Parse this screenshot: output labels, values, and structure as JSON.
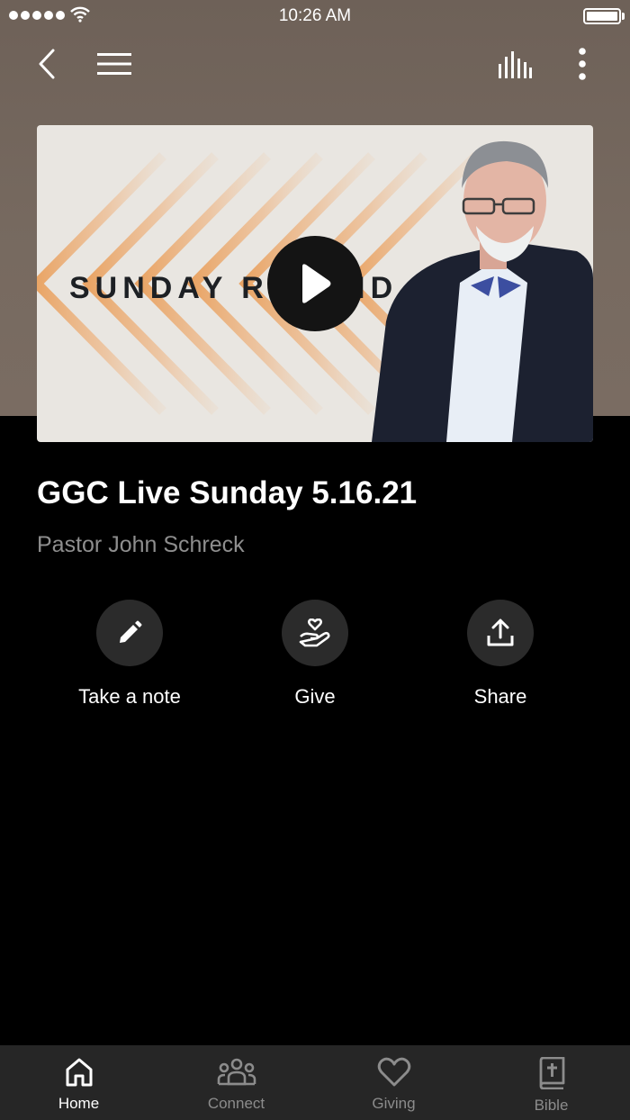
{
  "status_bar": {
    "time": "10:26 AM"
  },
  "nav": {
    "back_icon": "chevron-left-icon",
    "menu_icon": "hamburger-menu-icon",
    "audio_icon": "audio-bars-icon",
    "more_icon": "more-vertical-icon"
  },
  "video": {
    "thumbnail_text": "SUNDAY REWIND",
    "play_icon": "play-icon"
  },
  "sermon": {
    "title": "GGC Live Sunday 5.16.21",
    "speaker": "Pastor John Schreck"
  },
  "actions": [
    {
      "label": "Take a note",
      "icon": "pencil-icon"
    },
    {
      "label": "Give",
      "icon": "hand-heart-icon"
    },
    {
      "label": "Share",
      "icon": "share-upload-icon"
    }
  ],
  "tabs": [
    {
      "label": "Home",
      "icon": "home-icon",
      "active": true
    },
    {
      "label": "Connect",
      "icon": "people-icon",
      "active": false
    },
    {
      "label": "Giving",
      "icon": "heart-icon",
      "active": false
    },
    {
      "label": "Bible",
      "icon": "bible-icon",
      "active": false
    }
  ],
  "colors": {
    "header_bg": "#776a60",
    "background": "#000000",
    "tab_bar": "#262626",
    "action_circle": "#2b2b2b",
    "speaker_text": "#8e8e8e",
    "chevron_orange": "#e9a15f"
  }
}
